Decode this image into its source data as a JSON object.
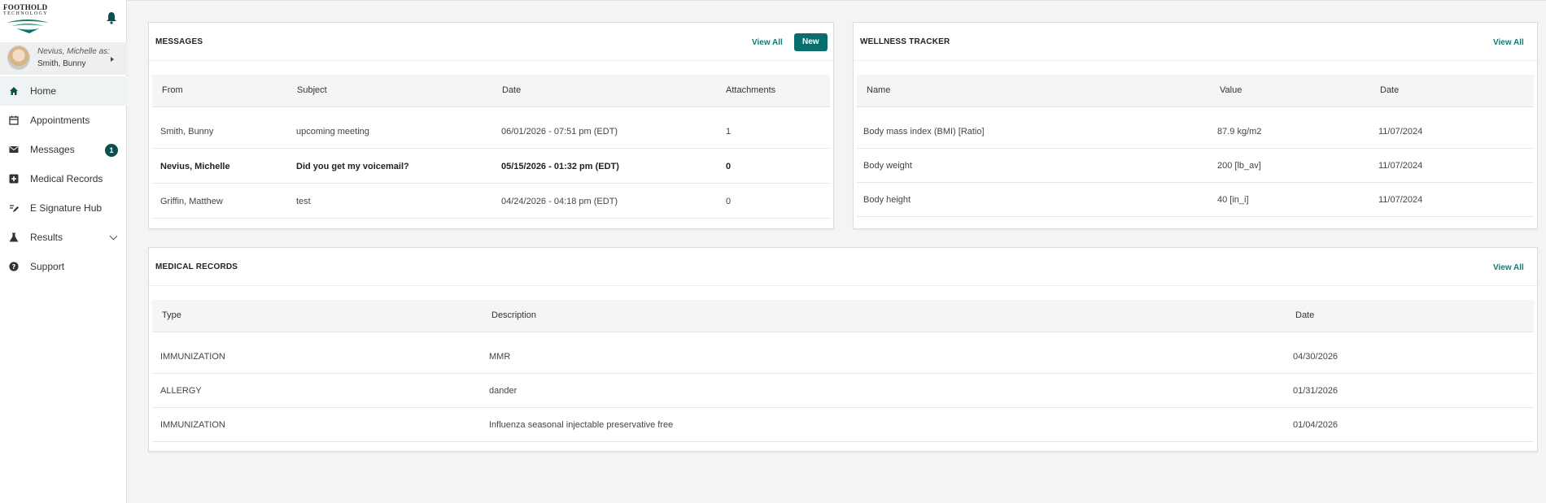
{
  "sidebar": {
    "logo": {
      "line1": "FOOTHOLD",
      "line2": "TECHNOLOGY"
    },
    "user": {
      "acting_as": "Nevius, Michelle as:",
      "name": "Smith, Bunny"
    },
    "items": [
      {
        "label": "Home",
        "icon": "home-icon",
        "active": true
      },
      {
        "label": "Appointments",
        "icon": "calendar-icon"
      },
      {
        "label": "Messages",
        "icon": "mail-icon",
        "badge": "1"
      },
      {
        "label": "Medical Records",
        "icon": "plus-box-icon"
      },
      {
        "label": "E Signature Hub",
        "icon": "signature-icon"
      },
      {
        "label": "Results",
        "icon": "flask-icon",
        "expandable": true
      },
      {
        "label": "Support",
        "icon": "help-circle-icon"
      }
    ]
  },
  "messages": {
    "title": "MESSAGES",
    "view_all": "View All",
    "new_label": "New",
    "columns": [
      "From",
      "Subject",
      "Date",
      "Attachments"
    ],
    "rows": [
      {
        "from": "Smith, Bunny",
        "subject": "upcoming meeting",
        "date": "06/01/2026 - 07:51 pm (EDT)",
        "attachments": "1",
        "unread": false
      },
      {
        "from": "Nevius, Michelle",
        "subject": "Did you get my voicemail?",
        "date": "05/15/2026 - 01:32 pm (EDT)",
        "attachments": "0",
        "unread": true
      },
      {
        "from": "Griffin, Matthew",
        "subject": "test",
        "date": "04/24/2026 - 04:18 pm (EDT)",
        "attachments": "0",
        "unread": false
      }
    ]
  },
  "wellness": {
    "title": "WELLNESS TRACKER",
    "view_all": "View All",
    "columns": [
      "Name",
      "Value",
      "Date"
    ],
    "rows": [
      {
        "name": "Body mass index (BMI) [Ratio]",
        "value": "87.9 kg/m2",
        "date": "11/07/2024"
      },
      {
        "name": "Body weight",
        "value": "200 [lb_av]",
        "date": "11/07/2024"
      },
      {
        "name": "Body height",
        "value": "40 [in_i]",
        "date": "11/07/2024"
      }
    ]
  },
  "medical_records": {
    "title": "MEDICAL RECORDS",
    "view_all": "View All",
    "columns": [
      "Type",
      "Description",
      "Date"
    ],
    "rows": [
      {
        "type": "IMMUNIZATION",
        "description": "MMR",
        "date": "04/30/2026"
      },
      {
        "type": "ALLERGY",
        "description": "dander",
        "date": "01/31/2026"
      },
      {
        "type": "IMMUNIZATION",
        "description": "Influenza seasonal injectable preservative free",
        "date": "01/04/2026"
      }
    ]
  },
  "colors": {
    "accent": "#0e7a7a",
    "badge": "#0b4f4f",
    "button": "#0b6e6e"
  }
}
